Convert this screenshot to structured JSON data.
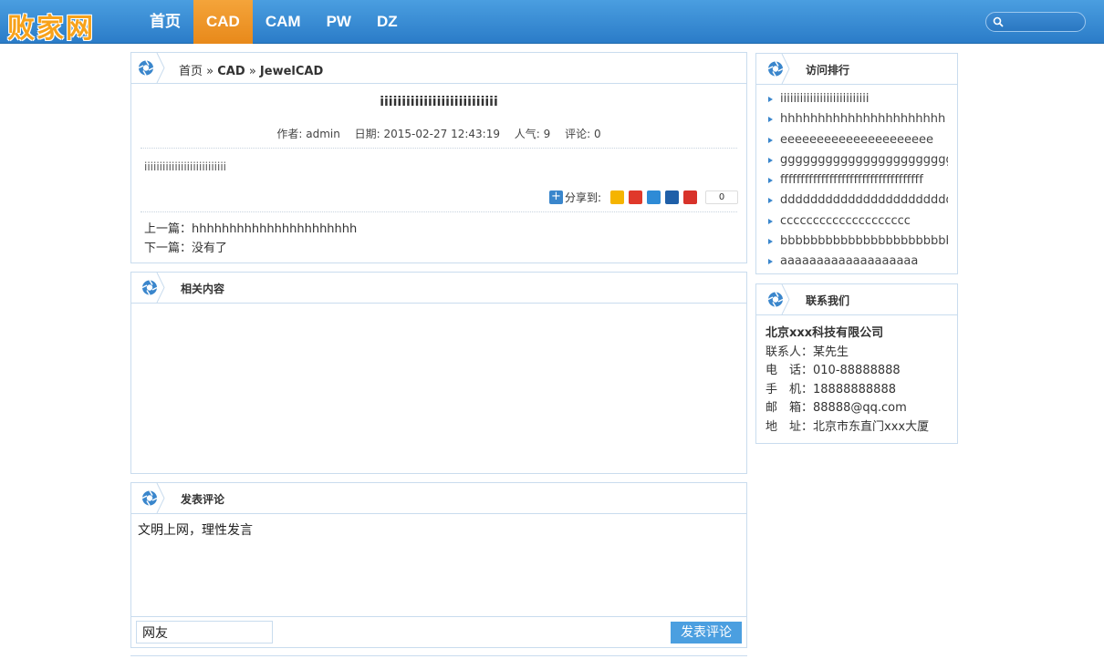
{
  "site": {
    "logo": "败家网"
  },
  "nav": {
    "items": [
      "首页",
      "CAD",
      "CAM",
      "PW",
      "DZ"
    ],
    "active_index": 1
  },
  "search": {
    "placeholder": ""
  },
  "breadcrumb": {
    "home": "首页",
    "sep": "»",
    "cat": "CAD",
    "sub": "JewelCAD"
  },
  "article": {
    "title": "iiiiiiiiiiiiiiiiiiiiiiiiiii",
    "author": "作者: admin",
    "date": "日期: 2015-02-27 12:43:19",
    "views": "人气: 9",
    "comments": "评论: 0",
    "body": "iiiiiiiiiiiiiiiiiiiiiiiiiii"
  },
  "share": {
    "label": "分享到:",
    "count": "0"
  },
  "prevnext": {
    "prev": "上一篇：hhhhhhhhhhhhhhhhhhhhhh",
    "next": "下一篇：没有了"
  },
  "related": {
    "title": "相关内容"
  },
  "comment_form": {
    "title": "发表评论",
    "text": "文明上网，理性发言",
    "nickname": "网友",
    "submit": "发表评论"
  },
  "ranking": {
    "title": "访问排行",
    "items": [
      "iiiiiiiiiiiiiiiiiiiiiiiiiii",
      "hhhhhhhhhhhhhhhhhhhhhh",
      "eeeeeeeeeeeeeeeeeeeee",
      "gggggggggggggggggggggggg",
      "fffffffffffffffffffffffffffffffffff",
      "ddddddddddddddddddddddddd",
      "cccccccccccccccccccc",
      "bbbbbbbbbbbbbbbbbbbbbbbb",
      "aaaaaaaaaaaaaaaaaaa"
    ]
  },
  "contact": {
    "title": "联系我们",
    "company": "北京xxx科技有限公司",
    "person": "联系人：某先生",
    "tel": "电　话：010-88888888",
    "mobile": "手　机：18888888888",
    "email": "邮　箱：88888@qq.com",
    "address": "地　址：北京市东直门xxx大厦"
  },
  "colors": {
    "header": "#2f82cc",
    "active_nav": "#ee921f",
    "logo": "#f7a21b",
    "panel_border": "#c9dcee",
    "button": "#4b9fe0"
  }
}
